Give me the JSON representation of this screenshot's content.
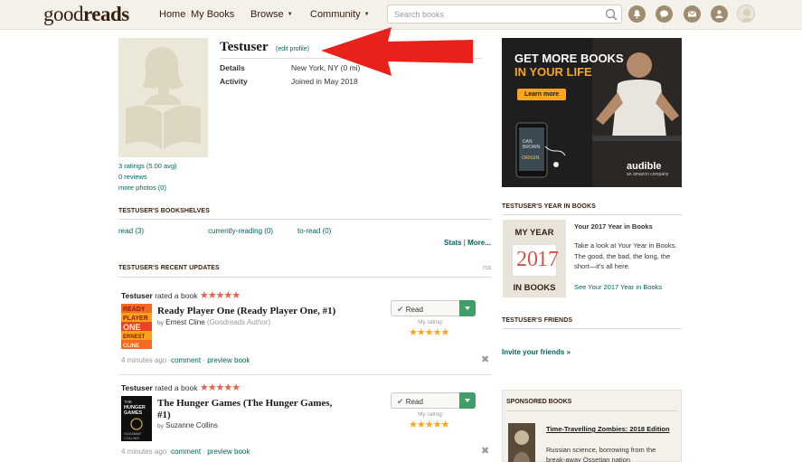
{
  "header": {
    "logo_light": "good",
    "logo_bold": "reads",
    "nav": [
      {
        "label": "Home"
      },
      {
        "label": "My Books"
      },
      {
        "label": "Browse",
        "caret": "▼"
      },
      {
        "label": "Community",
        "caret": "▼"
      }
    ],
    "search_placeholder": "Search books",
    "icons": [
      "bell-icon",
      "chat-icon",
      "mail-icon",
      "friends-icon"
    ]
  },
  "profile": {
    "name": "Testuser",
    "edit_link": "(edit profile)",
    "details_label": "Details",
    "details_value": "New York, NY (0 mi)",
    "activity_label": "Activity",
    "activity_value": "Joined in May 2018",
    "links": [
      "3 ratings (5.00 avg)",
      "0 reviews",
      "more photos (0)"
    ]
  },
  "bookshelves": {
    "heading": "TESTUSER'S BOOKSHELVES",
    "shelves": [
      "read (3)",
      "currently-reading (0)",
      "to-read (0)"
    ],
    "stats": "Stats",
    "sep": "|",
    "more": "More..."
  },
  "updates": {
    "heading": "TESTUSER'S RECENT UPDATES",
    "rss": "rss",
    "items": [
      {
        "user": "Testuser",
        "action": "rated a book",
        "stars": "★★★★★",
        "title": "Ready Player One (Ready Player One, #1)",
        "by": "by",
        "author": "Ernest Cline",
        "author_note": "(Goodreads Author)",
        "button": "Read",
        "my_rating": "My rating:",
        "rating_stars": "★★★★★",
        "time": "4 minutes ago",
        "comment": "comment",
        "preview": "preview book",
        "dot": "·",
        "cover_lines": [
          "READY",
          "PLAYER",
          "ONE",
          "ERNEST",
          "CLINE"
        ]
      },
      {
        "user": "Testuser",
        "action": "rated a book",
        "stars": "★★★★★",
        "title": "The Hunger Games (The Hunger Games, #1)",
        "by": "by",
        "author": "Suzanne Collins",
        "author_note": "",
        "button": "Read",
        "my_rating": "My rating:",
        "rating_stars": "★★★★★",
        "time": "4 minutes ago",
        "comment": "comment",
        "preview": "preview book",
        "dot": "·",
        "cover_lines": [
          "THE",
          "HUNGER",
          "GAMES",
          "SUZANNE",
          "COLLINS"
        ]
      }
    ]
  },
  "ad": {
    "line1": "GET MORE BOOKS",
    "line2": "IN YOUR LIFE",
    "cta": "Learn more",
    "brand": "audible",
    "brand_sub": "an amazon company",
    "book_lines": [
      "DAN",
      "BROWN",
      "ORIGIN"
    ]
  },
  "year_in_books": {
    "heading": "TESTUSER'S YEAR IN BOOKS",
    "box_top": "MY YEAR",
    "year_left": "20",
    "year_right": "17",
    "box_bottom": "IN BOOKS",
    "title": "Your 2017 Year in Books",
    "text": "Take a look at Your Year in Books. The good, the bad, the long, the short—it's all here.",
    "link": "See Your 2017 Year in Books"
  },
  "friends": {
    "heading": "TESTUSER'S FRIENDS",
    "invite": "Invite your friends »"
  },
  "sponsored": {
    "heading": "SPONSORED BOOKS",
    "title": "Time-Travelling Zombies: 2018 Edition",
    "desc": "Russian science, borrowing from the break-away Ossetian nation"
  },
  "colors": {
    "teal_link": "#00635d",
    "brown": "#382110",
    "star_red": "#e8614a",
    "star_orange": "#f5a623",
    "green_button": "#409d69",
    "annotation_arrow": "#e8211a"
  }
}
